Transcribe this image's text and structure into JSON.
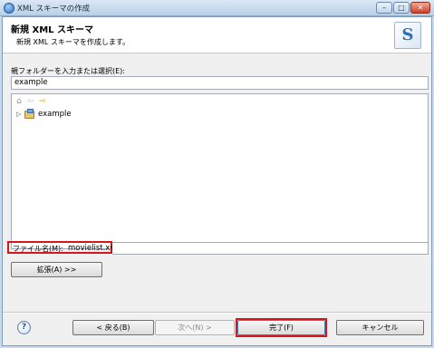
{
  "window": {
    "title": "XML スキーマの作成",
    "minimize_glyph": "–",
    "maximize_glyph": "□",
    "close_glyph": "✕"
  },
  "header": {
    "title": "新規 XML スキーマ",
    "description": "新規 XML スキーマを作成します。",
    "logo_letter": "S"
  },
  "parent_folder": {
    "label": "親フォルダーを入力または選択(E):",
    "value": "example"
  },
  "tree": {
    "toolbar": {
      "home_glyph": "⌂",
      "back_glyph": "⇦",
      "forward_glyph": "⇨"
    },
    "items": [
      {
        "expander": "▷",
        "label": "example"
      }
    ]
  },
  "file_name": {
    "label": "ファイル名(M):",
    "value": "movielist.xsd"
  },
  "buttons": {
    "advanced": "拡張(A) >>",
    "help_glyph": "?",
    "back": "< 戻る(B)",
    "next": "次へ(N) >",
    "finish": "完了(F)",
    "cancel": "キャンセル"
  },
  "colors": {
    "highlight_border": "#d8151b",
    "dialog_background": "#f0f0f0"
  }
}
